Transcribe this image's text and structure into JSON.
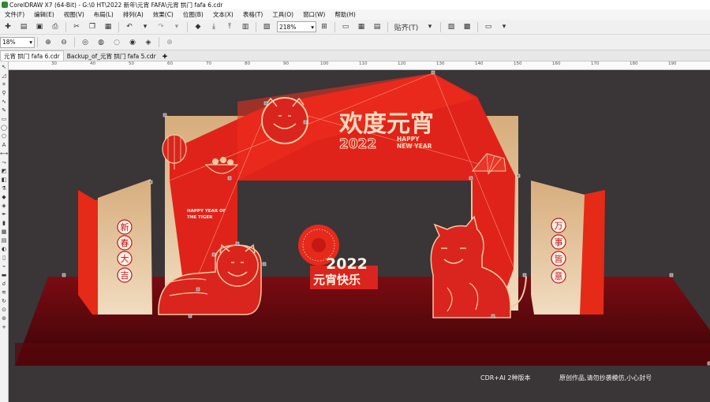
{
  "window": {
    "title": "CorelDRAW X7 (64-Bit) - G:\\0 HT\\2022 新年\\元宵 FAFA\\元宵 拱门 fafa 6.cdr"
  },
  "menu": [
    "文件(F)",
    "编辑(E)",
    "视图(V)",
    "布局(L)",
    "排列(A)",
    "效果(C)",
    "位图(B)",
    "文本(X)",
    "表格(T)",
    "工具(O)",
    "窗口(W)",
    "帮助(H)"
  ],
  "toolbar": {
    "zoom_value": "218%",
    "snap_label": "贴齐(T)"
  },
  "toolbar2": {
    "zoom_value": "18%"
  },
  "tabs": [
    {
      "label": "元宵 拱门 fafa 6.cdr"
    },
    {
      "label": "Backup_of_元宵 拱门 fafa 5.cdr"
    }
  ],
  "ruler_ticks": [
    "30",
    "40",
    "50",
    "60",
    "70",
    "80",
    "90",
    "100",
    "110",
    "120",
    "130",
    "140",
    "150",
    "160",
    "170",
    "180",
    "190"
  ],
  "artwork": {
    "headline": "欢度元宵",
    "year": "2022",
    "happy_new_year": [
      "HAPPY",
      "NEW YEAR"
    ],
    "tiger_caption": [
      "HAPPY YEAR OF",
      "THE TIGER"
    ],
    "left_panel": [
      "新",
      "春",
      "大",
      "吉"
    ],
    "right_panel": [
      "万",
      "事",
      "皆",
      "意"
    ],
    "center_year": "2022",
    "center_text": "元宵快乐",
    "watermark_left": "CDR+AI 2种版本",
    "watermark_right": "原创作品,请勿抄袭模仿,小心封号"
  }
}
